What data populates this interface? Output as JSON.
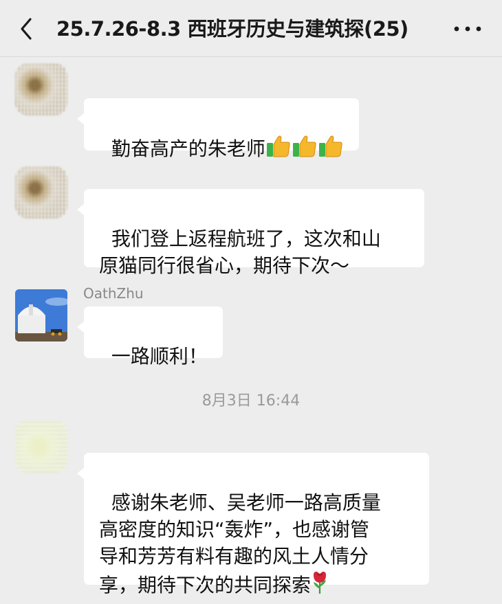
{
  "header": {
    "title": "25.7.26-8.3 西班牙历史与建筑探",
    "member_count": "(25)",
    "back_icon": "chevron-left-icon",
    "more_icon": "ellipsis-icon"
  },
  "messages": [
    {
      "text": "勤奋高产的朱老师",
      "emoji": [
        "thumbs-up-icon",
        "thumbs-up-icon",
        "thumbs-up-icon"
      ]
    },
    {
      "text": "我们登上返程航班了，这次和山\n原猫同行很省心，期待下次～"
    },
    {
      "sender": "OathZhu",
      "text": "一路顺利！"
    },
    {
      "text": "感谢朱老师、吴老师一路高质量\n高密度的知识“轰炸”，也感谢管\n导和芳芳有料有趣的风土人情分\n享，期待下次的共同探索",
      "emoji": [
        "rose-icon"
      ]
    }
  ],
  "timestamp": "8月3日 16:44",
  "colors": {
    "background": "#ededed",
    "bubble": "#ffffff",
    "text": "#111111",
    "meta_text": "#9a9a9a"
  }
}
